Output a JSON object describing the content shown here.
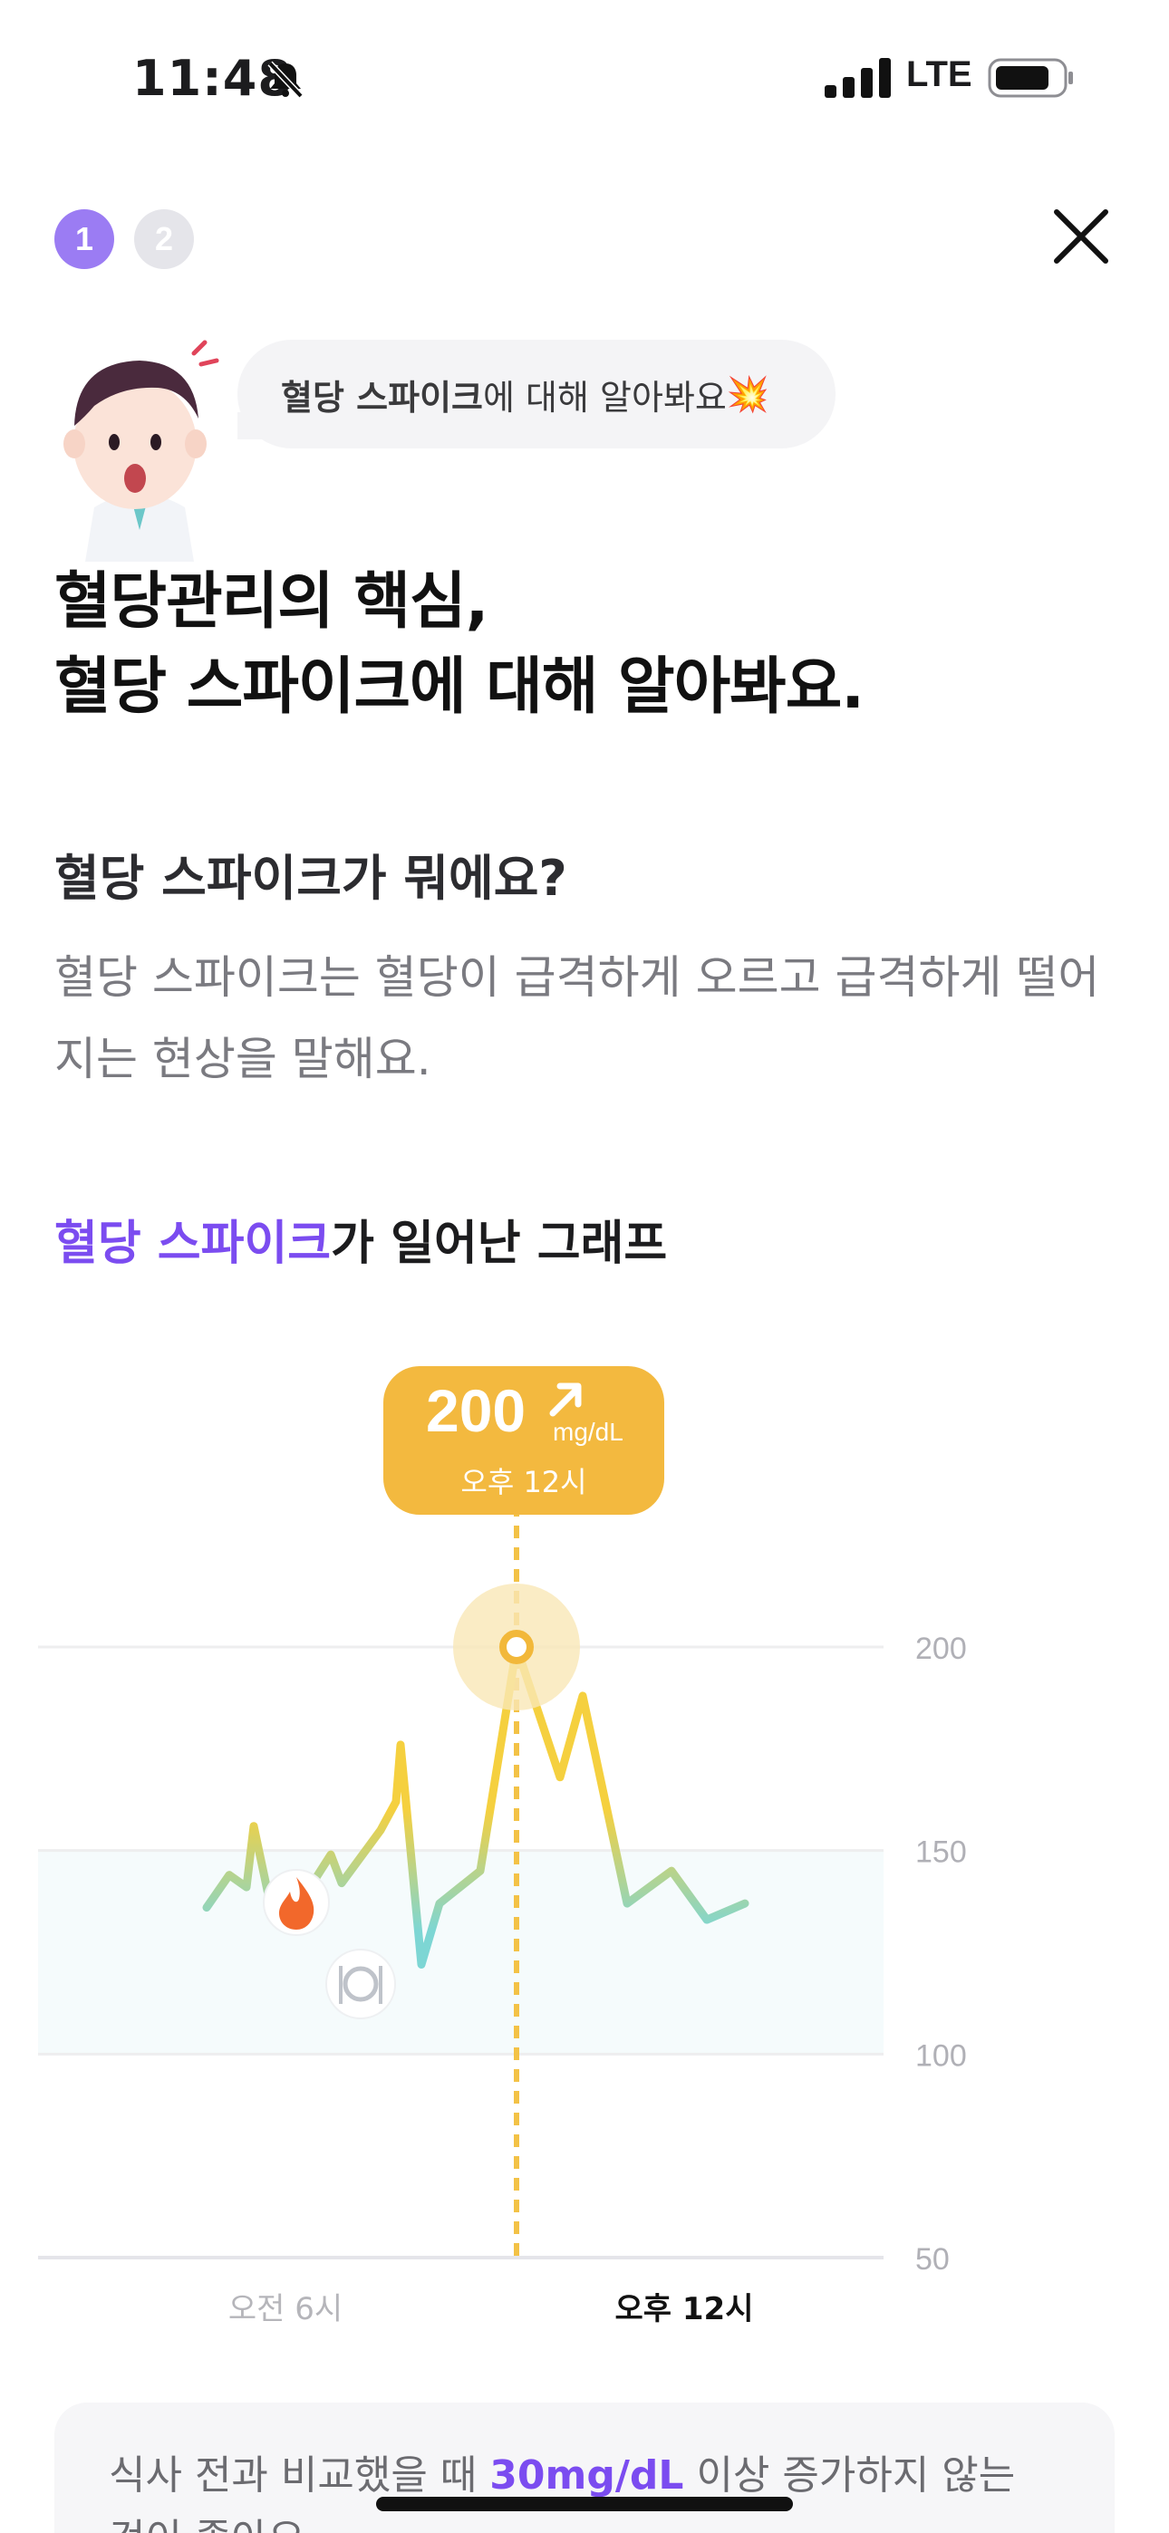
{
  "status_bar": {
    "time": "11:48",
    "network": "LTE",
    "icons": [
      "bell-slash-icon",
      "signal-icon",
      "battery-icon"
    ]
  },
  "header": {
    "steps": [
      "1",
      "2"
    ],
    "current_step": 1,
    "close_icon": "close-icon"
  },
  "bubble": {
    "bold": "혈당 스파이크",
    "rest": "에 대해 알아봐요",
    "emoji": "💥"
  },
  "title": {
    "line1": "혈당관리의 핵심,",
    "line2": "혈당 스파이크에 대해 알아봐요."
  },
  "question": {
    "title": "혈당 스파이크가 뭐에요?",
    "body": "혈당 스파이크는 혈당이 급격하게 오르고 급격하게 떨어지는 현상을 말해요."
  },
  "graph_title": {
    "accent": "혈당 스파이크",
    "rest": "가 일어난 그래프"
  },
  "chart_data": {
    "type": "line",
    "ylim": [
      50,
      200
    ],
    "y_ticks": [
      "200",
      "150",
      "100",
      "50"
    ],
    "x_ticks": [
      "오전 6시",
      "오후 12시"
    ],
    "normal_range": [
      100,
      150
    ],
    "series": [
      {
        "values": [
          136,
          144,
          141,
          156,
          135,
          135,
          149,
          142,
          155,
          162,
          176,
          122,
          137,
          145,
          200,
          168,
          188,
          137,
          145,
          133,
          137
        ]
      }
    ],
    "peak": {
      "value": "200",
      "unit": "mg/dL",
      "time": "오후 12시",
      "arrow_icon": "arrow-up-right-icon"
    },
    "markers": [
      "fire-icon",
      "meal-icon"
    ],
    "colors": {
      "normal": "#7dd6d4",
      "high": "#f5d03f",
      "tooltip": "#f3b93f",
      "range_fill": "#f5fbfc"
    }
  },
  "info_card": {
    "before": "식사 전과 비교했을 때 ",
    "accent": "30mg/dL",
    "after": " 이상 증가하지 않는",
    "line2": "것이 좋아요."
  }
}
